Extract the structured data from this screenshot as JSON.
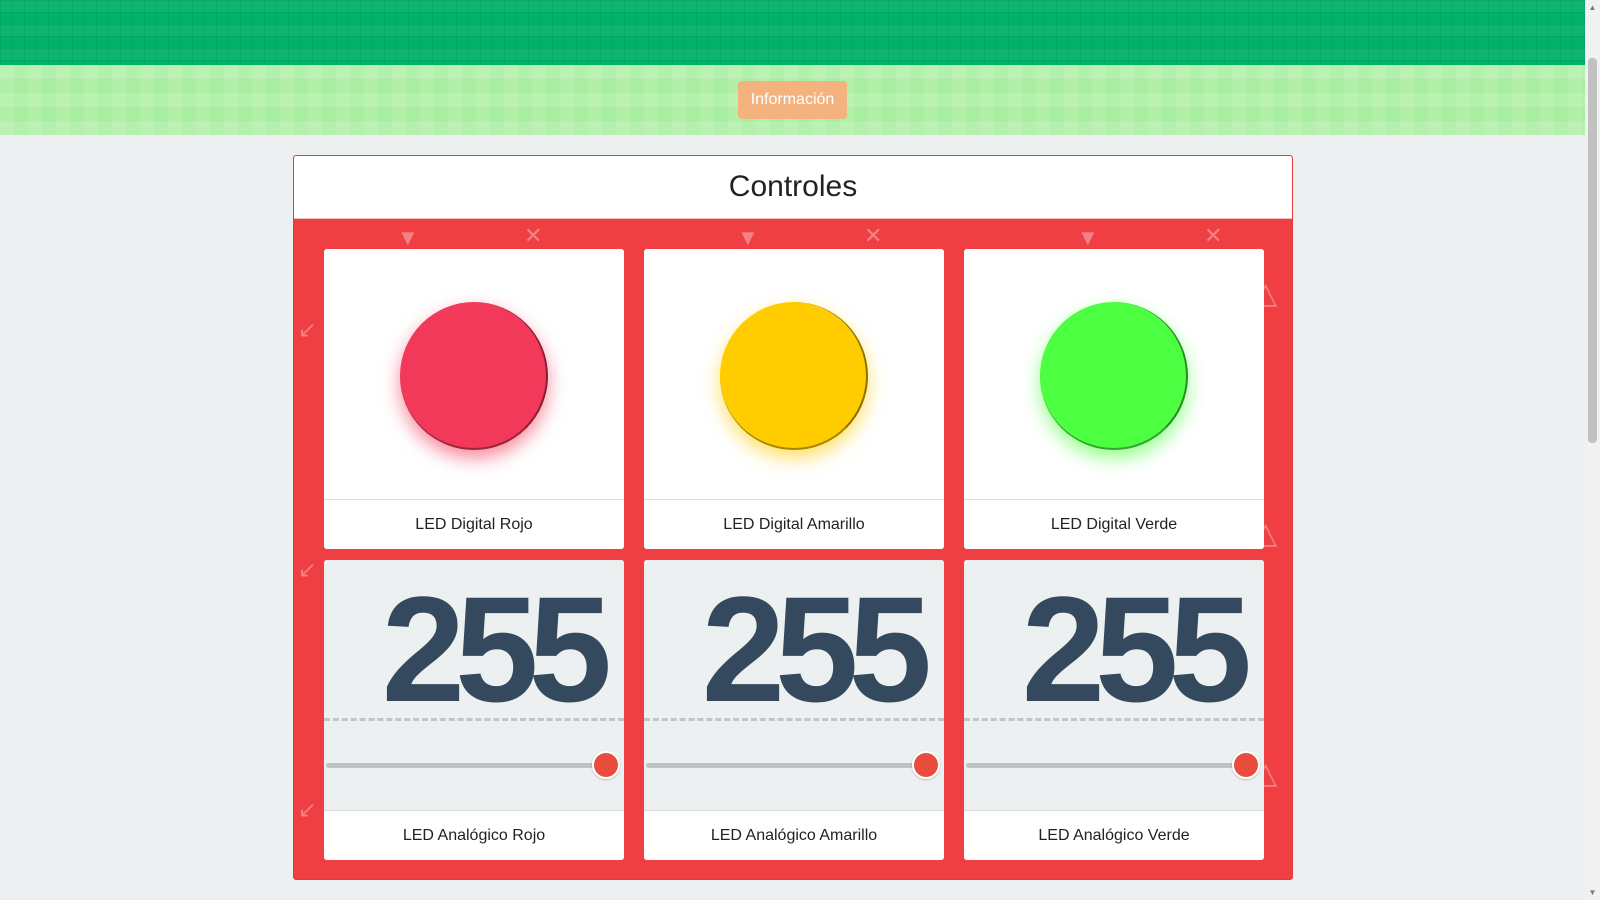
{
  "header": {
    "info_button": "Información"
  },
  "panel": {
    "title": "Controles"
  },
  "digital_leds": [
    {
      "label": "LED Digital Rojo",
      "color": "#f2395a"
    },
    {
      "label": "LED Digital Amarillo",
      "color": "#ffcc00"
    },
    {
      "label": "LED Digital Verde",
      "color": "#4cff40"
    }
  ],
  "analog_leds": [
    {
      "label": "LED Analógico Rojo",
      "value": "255",
      "slider_fraction": 1.0
    },
    {
      "label": "LED Analógico Amarillo",
      "value": "255",
      "slider_fraction": 1.0
    },
    {
      "label": "LED Analógico Verde",
      "value": "255",
      "slider_fraction": 1.0
    }
  ],
  "colors": {
    "topbar": "#00b16a",
    "infobar": "#a9eea0",
    "info_button": "#f3b27e",
    "panel_bg": "#ef3f43",
    "value_text": "#34495e",
    "slider_knob": "#e74c3c"
  },
  "icons": [
    "triangle-down-icon",
    "x-mark-icon",
    "arrow-icon",
    "triangle-outline-icon"
  ]
}
